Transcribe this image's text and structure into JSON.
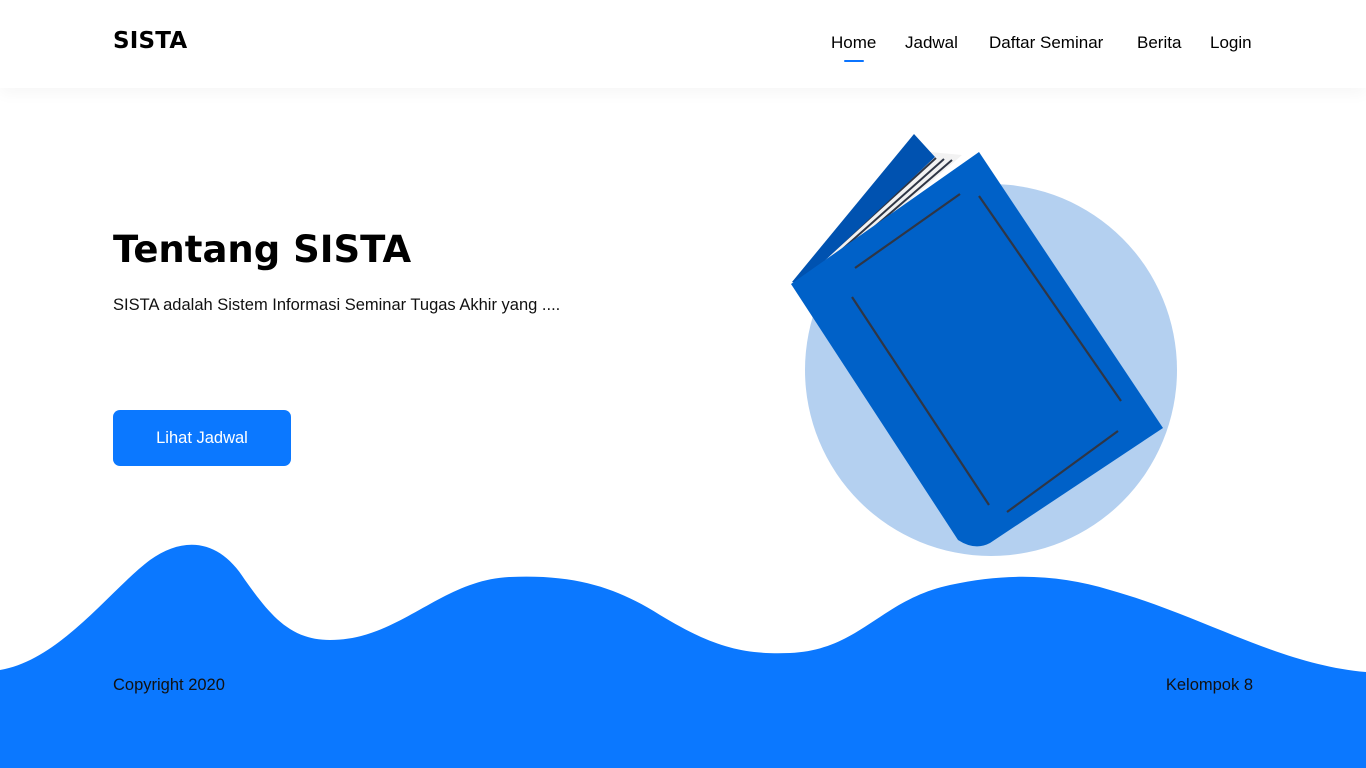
{
  "brand": "SISTA",
  "nav": {
    "items": [
      {
        "label": "Home",
        "active": true
      },
      {
        "label": "Jadwal",
        "active": false
      },
      {
        "label": "Daftar Seminar",
        "active": false
      },
      {
        "label": "Berita",
        "active": false
      },
      {
        "label": "Login",
        "active": false
      }
    ]
  },
  "hero": {
    "title": "Tentang SISTA",
    "description": "SISTA adalah Sistem Informasi Seminar Tugas Akhir yang ....",
    "cta_label": "Lihat Jadwal",
    "illustration": "book-illustration"
  },
  "footer": {
    "copyright": "Copyright 2020",
    "group": "Kelompok 8"
  },
  "colors": {
    "primary": "#0B78FF",
    "book": "#0061C8",
    "circle": "#B4D0F0",
    "text": "#000000"
  }
}
